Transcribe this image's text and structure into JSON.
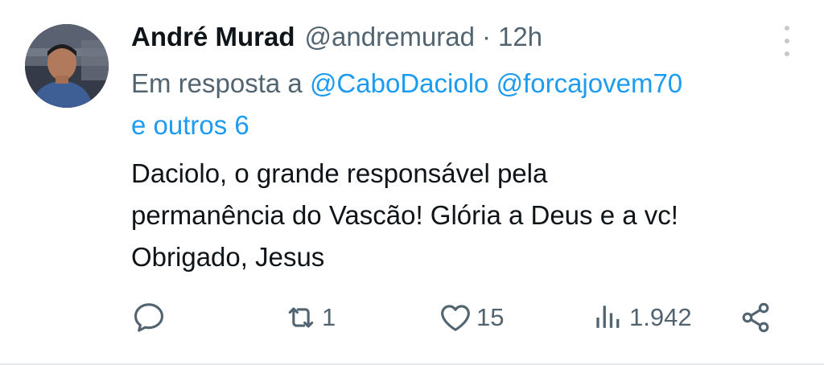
{
  "tweet": {
    "author_name": "André Murad",
    "handle": "@andremurad",
    "separator": "·",
    "time": "12h",
    "reply_prefix": "Em resposta a",
    "mentions": [
      "@CaboDaciolo",
      "@forcajovem70"
    ],
    "others": "e outros 6",
    "text_lines": [
      "Daciolo, o grande responsável pela",
      "permanência do Vascão! Glória a Deus e a vc!",
      "Obrigado, Jesus"
    ]
  },
  "actions": {
    "reply": {
      "icon": "reply-icon",
      "count": ""
    },
    "retweet": {
      "icon": "retweet-icon",
      "count": "1"
    },
    "like": {
      "icon": "heart-icon",
      "count": "15"
    },
    "views": {
      "icon": "views-icon",
      "count": "1.942"
    },
    "share": {
      "icon": "share-icon",
      "count": ""
    }
  },
  "colors": {
    "text_primary": "#0f1419",
    "text_secondary": "#536471",
    "link": "#1d9bf0",
    "divider": "#e7e9ea"
  }
}
